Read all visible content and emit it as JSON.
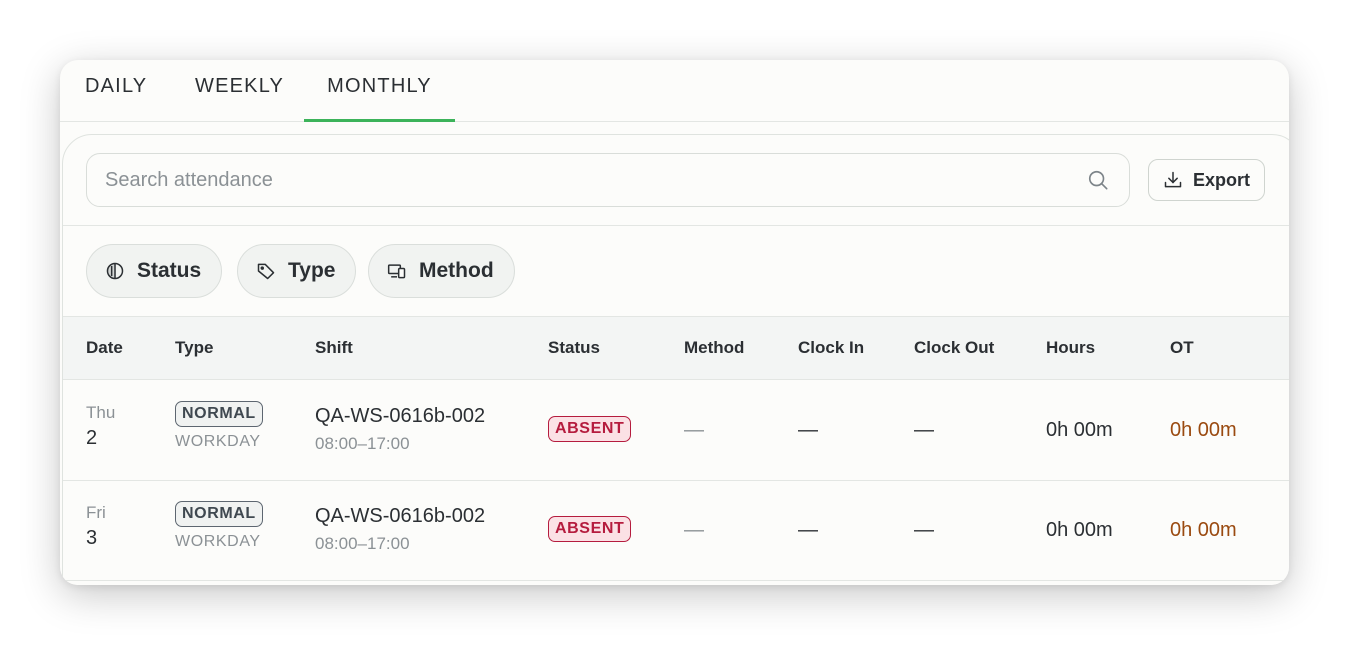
{
  "tabs": [
    {
      "label": "DAILY"
    },
    {
      "label": "WEEKLY"
    },
    {
      "label": "MONTHLY",
      "active": true
    }
  ],
  "search": {
    "placeholder": "Search attendance"
  },
  "export": {
    "label": "Export"
  },
  "filters": [
    {
      "label": "Status",
      "icon": "contrast-icon"
    },
    {
      "label": "Type",
      "icon": "tag-icon"
    },
    {
      "label": "Method",
      "icon": "devices-icon"
    }
  ],
  "table": {
    "columns": [
      "Date",
      "Type",
      "Shift",
      "Status",
      "Method",
      "Clock In",
      "Clock Out",
      "Hours",
      "OT"
    ],
    "rows": [
      {
        "dow": "Thu",
        "day": "2",
        "type": "NORMAL",
        "type_sub": "WORKDAY",
        "shift": "QA-WS-0616b-002",
        "shift_time": "08:00–17:00",
        "status": "ABSENT",
        "method": "—",
        "clock_in": "—",
        "clock_out": "—",
        "hours": "0h 00m",
        "ot": "0h 00m"
      },
      {
        "dow": "Fri",
        "day": "3",
        "type": "NORMAL",
        "type_sub": "WORKDAY",
        "shift": "QA-WS-0616b-002",
        "shift_time": "08:00–17:00",
        "status": "ABSENT",
        "method": "—",
        "clock_in": "—",
        "clock_out": "—",
        "hours": "0h 00m",
        "ot": "0h 00m"
      }
    ]
  },
  "colors": {
    "accent": "#3cb35a",
    "absent": "#b51c3e",
    "ot": "#9a4a10"
  }
}
